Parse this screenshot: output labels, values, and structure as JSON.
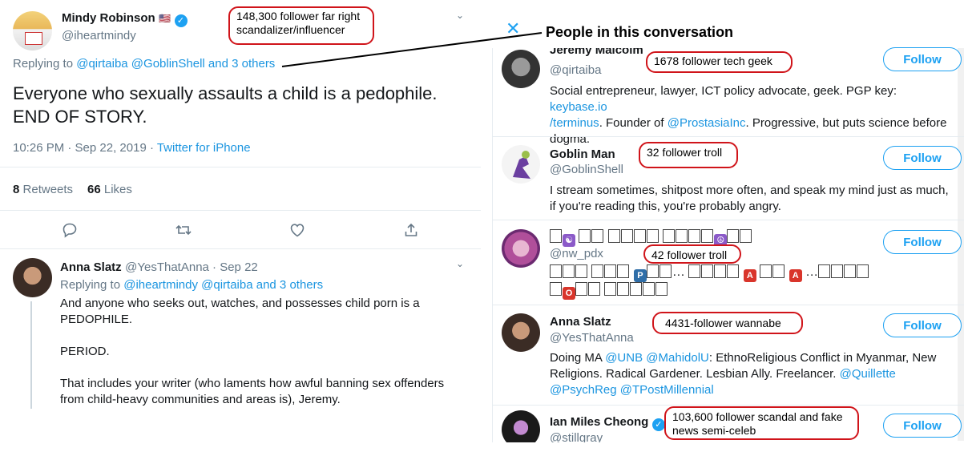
{
  "tweet": {
    "name": "Mindy Robinson",
    "flag": "🇺🇸",
    "handle": "@iheartmindy",
    "replying_prefix": "Replying to",
    "replying_links": "@qirtaiba @GoblinShell and 3 others",
    "text_line1": "Everyone who sexually assaults a child is a pedophile.",
    "text_line2": "END OF STORY.",
    "timestamp": "10:26 PM · Sep 22, 2019 · ",
    "source": "Twitter for iPhone",
    "retweets_count": "8",
    "retweets_label": "Retweets",
    "likes_count": "66",
    "likes_label": "Likes"
  },
  "reply": {
    "name": "Anna Slatz",
    "handle_time": "@YesThatAnna · Sep 22",
    "replying_prefix": "Replying to",
    "replying_links": "@iheartmindy @qirtaiba and 3 others",
    "line1": "And anyone who seeks out, watches, and possesses child porn is a",
    "line2": "PEDOPHILE.",
    "line3": "PERIOD.",
    "line4": "That includes your writer (who laments how awful banning sex offenders",
    "line5": "from child-heavy communities and areas is), Jeremy."
  },
  "annotations": {
    "mindy": "148,300 follower far right scandalizer/influencer",
    "jeremy": "1678 follower tech geek",
    "goblin": "32 follower troll",
    "nw": "42 follower troll",
    "anna": "4431-follower wannabe",
    "ian": "103,600 follower scandal and fake news semi-celeb"
  },
  "panel": {
    "title": "People in this conversation",
    "close_icon": "close-icon",
    "follow_label": "Follow"
  },
  "users": {
    "jeremy": {
      "name": "Jeremy Malcolm",
      "handle": "@qirtaiba",
      "bio1_a": "Social entrepreneur, lawyer, ICT policy advocate, geek. PGP key: ",
      "bio1_link": "keybase.io",
      "bio2_link": "/terminus",
      "bio2_a": ". Founder of ",
      "bio2_link2": "@ProstasiaInc",
      "bio2_b": ". Progressive, but puts science before",
      "bio3": "dogma."
    },
    "goblin": {
      "name": "Goblin Man",
      "handle": "@GoblinShell",
      "bio1": "I stream sometimes, shitpost more often, and speak my mind just as much,",
      "bio2": "if you're reading this, you're probably angry."
    },
    "nw": {
      "handle": "@nw_pdx"
    },
    "anna": {
      "name": "Anna Slatz",
      "handle": "@YesThatAnna",
      "bio1_a": "Doing MA ",
      "bio1_l1": "@UNB",
      "bio1_l2": "@MahidolU",
      "bio1_b": ": EthnoReligious Conflict in Myanmar, New",
      "bio2_a": "Religions. Radical Gardener. Lesbian Ally. Freelancer. ",
      "bio2_l1": "@Quillette",
      "bio3_l1": "@PsychReg",
      "bio3_l2": "@TPostMillennial"
    },
    "ian": {
      "name": "Ian Miles Cheong",
      "handle": "@stillgray"
    }
  },
  "colors": {
    "link": "#1b95e0",
    "annotation_border": "#d0141a",
    "verified": "#1da1f2"
  }
}
